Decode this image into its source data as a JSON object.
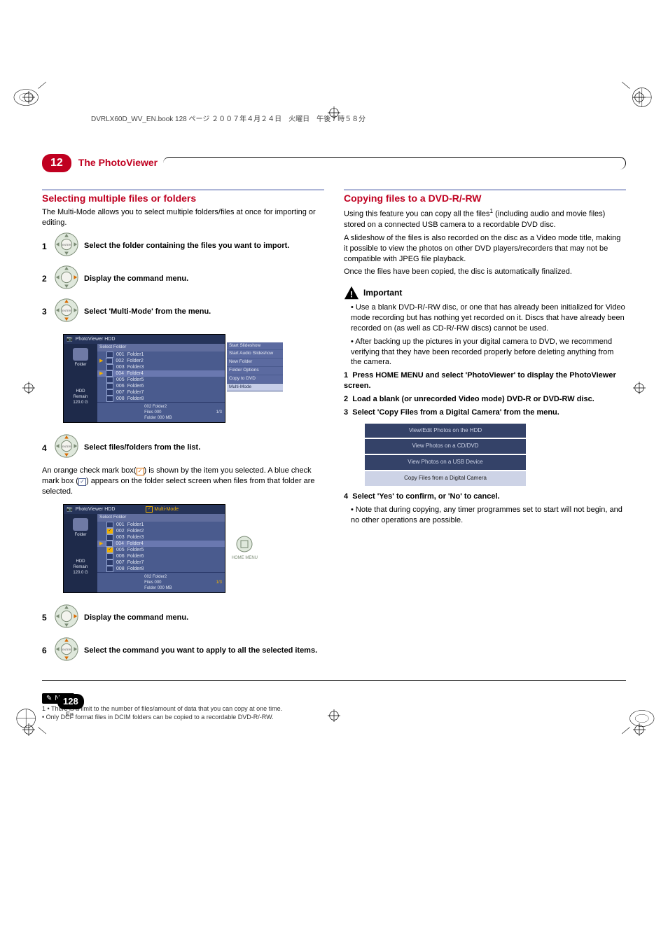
{
  "header_line": "DVRLX60D_WV_EN.book  128 ページ  ２００７年４月２４日　火曜日　午後７時５８分",
  "chapter": {
    "num": "12",
    "title": "The PhotoViewer"
  },
  "left": {
    "h": "Selecting multiple files or folders",
    "intro": "The Multi-Mode allows you to select multiple folders/files at once for importing or editing.",
    "steps": {
      "s1": {
        "n": "1",
        "text": "Select the folder containing the files you want to import."
      },
      "s2": {
        "n": "2",
        "text": "Display the command menu."
      },
      "s3": {
        "n": "3",
        "text": "Select 'Multi-Mode' from the menu."
      },
      "s4": {
        "n": "4",
        "text": "Select files/folders from the list."
      },
      "s4_after_a": "An orange check mark box(",
      "s4_after_b": ") is shown by the item you selected. A blue check mark box (",
      "s4_after_c": ") appears on the folder select screen when files from that folder are selected.",
      "s5": {
        "n": "5",
        "text": "Display the command menu."
      },
      "s6": {
        "n": "6",
        "text": "Select the command you want to apply to all the selected items."
      }
    },
    "ui1": {
      "title": "PhotoViewer  HDD",
      "list_head": "Select Folder",
      "side_label": "Folder",
      "hdd": "HDD",
      "remain": "120.0 G",
      "rows": [
        {
          "num": "001",
          "name": "Folder1"
        },
        {
          "num": "002",
          "name": "Folder2"
        },
        {
          "num": "003",
          "name": "Folder3"
        },
        {
          "num": "004",
          "name": "Folder4"
        },
        {
          "num": "005",
          "name": "Folder5"
        },
        {
          "num": "006",
          "name": "Folder6"
        },
        {
          "num": "007",
          "name": "Folder7"
        },
        {
          "num": "008",
          "name": "Folder8"
        }
      ],
      "menu": [
        "Start Slideshow",
        "Start Audio Slideshow",
        "New Folder",
        "Folder Options",
        "Copy to DVD",
        "Multi-Mode"
      ],
      "footer_left": "Remain",
      "footer_mid_a": "002 Folder2",
      "footer_mid_b": "Files     000",
      "footer_mid_c": "Folder   000 MB",
      "footer_right": "1/3"
    },
    "ui2": {
      "title": "PhotoViewer  HDD",
      "multi": "Multi-Mode",
      "list_head": "Select Folder",
      "side_label": "Folder",
      "hdd": "HDD",
      "remain": "120.0 G",
      "rows": [
        {
          "num": "001",
          "name": "Folder1",
          "chk": false
        },
        {
          "num": "002",
          "name": "Folder2",
          "chk": true
        },
        {
          "num": "003",
          "name": "Folder3",
          "chk": false
        },
        {
          "num": "004",
          "name": "Folder4",
          "chk": false
        },
        {
          "num": "005",
          "name": "Folder5",
          "chk": true
        },
        {
          "num": "006",
          "name": "Folder6",
          "chk": false
        },
        {
          "num": "007",
          "name": "Folder7",
          "chk": false
        },
        {
          "num": "008",
          "name": "Folder8",
          "chk": false
        }
      ],
      "home_menu": "HOME MENU",
      "footer_mid_a": "002 Folder2",
      "footer_mid_b": "Files     000",
      "footer_mid_c": "Folder   000 MB",
      "footer_right": "1/3"
    }
  },
  "right": {
    "h": "Copying files to a DVD-R/-RW",
    "p1_a": "Using this feature you can copy all the files",
    "p1_sup": "1",
    "p1_b": " (including audio and movie files) stored on a connected USB camera to a recordable DVD disc.",
    "p2": "A slideshow of the files is also recorded on the disc as a Video mode title, making it possible to view the photos on other DVD players/recorders that may not be compatible with JPEG file playback.",
    "p3": "Once the files have been copied, the disc is automatically finalized.",
    "important": "Important",
    "b1": "Use a blank DVD-R/-RW disc, or one that has already been initialized for Video mode recording but has nothing yet recorded on it. Discs that have already been recorded on (as well as CD-R/-RW discs) cannot be used.",
    "b2": "After backing up the pictures in your digital camera to DVD, we recommend verifying that they have been recorded properly before deleting anything from the camera.",
    "s1": {
      "n": "1",
      "text": "Press HOME MENU and select 'PhotoViewer' to display the PhotoViewer screen."
    },
    "s2": {
      "n": "2",
      "text": "Load a blank (or unrecorded Video mode) DVD-R or DVD-RW disc."
    },
    "s3": {
      "n": "3",
      "text": "Select 'Copy Files from a Digital Camera' from the menu."
    },
    "menu": [
      "View/Edit Photos on the HDD",
      "View Photos on a CD/DVD",
      "View Photos on a USB Device",
      "Copy Files from a Digital Camera"
    ],
    "s4": {
      "n": "4",
      "text": "Select 'Yes' to confirm, or 'No' to cancel."
    },
    "s4_note": "Note that during copying, any timer programmes set to start will not begin, and no other operations are possible."
  },
  "note_label": "Note",
  "footnote1": "1 • There is a limit to the number of files/amount of data that you can copy at one time.",
  "footnote2": "   • Only DCF format files in DCIM folders can be copied to a recordable DVD-R/-RW.",
  "page_num": "128",
  "page_lang": "En"
}
